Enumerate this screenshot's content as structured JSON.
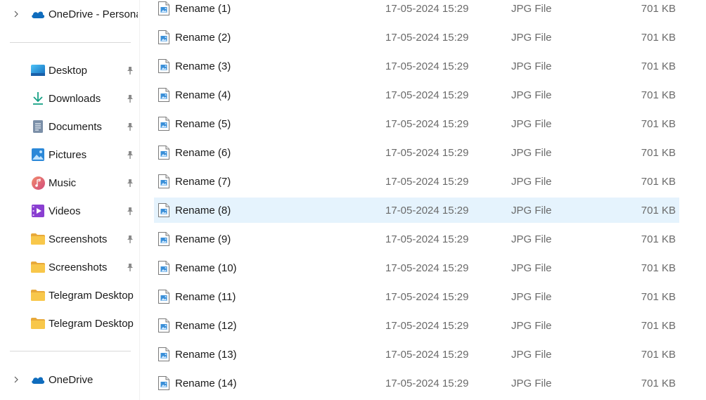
{
  "sidebar": {
    "top_item": {
      "label": "OneDrive - Persona",
      "icon": "onedrive-icon"
    },
    "quick_access": [
      {
        "label": "Desktop",
        "icon": "desktop-icon",
        "pinned": true
      },
      {
        "label": "Downloads",
        "icon": "downloads-icon",
        "pinned": true
      },
      {
        "label": "Documents",
        "icon": "documents-icon",
        "pinned": true
      },
      {
        "label": "Pictures",
        "icon": "pictures-icon",
        "pinned": true
      },
      {
        "label": "Music",
        "icon": "music-icon",
        "pinned": true
      },
      {
        "label": "Videos",
        "icon": "videos-icon",
        "pinned": true
      },
      {
        "label": "Screenshots",
        "icon": "folder-icon",
        "pinned": true
      },
      {
        "label": "Screenshots",
        "icon": "folder-icon",
        "pinned": true
      },
      {
        "label": "Telegram Desktop",
        "icon": "folder-icon",
        "pinned": false
      },
      {
        "label": "Telegram Desktop",
        "icon": "folder-icon",
        "pinned": false
      }
    ],
    "bottom_item": {
      "label": "OneDrive",
      "icon": "onedrive-icon"
    }
  },
  "files": [
    {
      "name": "Rename (1)",
      "date": "17-05-2024 15:29",
      "type": "JPG File",
      "size": "701 KB"
    },
    {
      "name": "Rename (2)",
      "date": "17-05-2024 15:29",
      "type": "JPG File",
      "size": "701 KB"
    },
    {
      "name": "Rename (3)",
      "date": "17-05-2024 15:29",
      "type": "JPG File",
      "size": "701 KB"
    },
    {
      "name": "Rename (4)",
      "date": "17-05-2024 15:29",
      "type": "JPG File",
      "size": "701 KB"
    },
    {
      "name": "Rename (5)",
      "date": "17-05-2024 15:29",
      "type": "JPG File",
      "size": "701 KB"
    },
    {
      "name": "Rename (6)",
      "date": "17-05-2024 15:29",
      "type": "JPG File",
      "size": "701 KB"
    },
    {
      "name": "Rename (7)",
      "date": "17-05-2024 15:29",
      "type": "JPG File",
      "size": "701 KB"
    },
    {
      "name": "Rename (8)",
      "date": "17-05-2024 15:29",
      "type": "JPG File",
      "size": "701 KB",
      "selected": true
    },
    {
      "name": "Rename (9)",
      "date": "17-05-2024 15:29",
      "type": "JPG File",
      "size": "701 KB"
    },
    {
      "name": "Rename (10)",
      "date": "17-05-2024 15:29",
      "type": "JPG File",
      "size": "701 KB"
    },
    {
      "name": "Rename (11)",
      "date": "17-05-2024 15:29",
      "type": "JPG File",
      "size": "701 KB"
    },
    {
      "name": "Rename (12)",
      "date": "17-05-2024 15:29",
      "type": "JPG File",
      "size": "701 KB"
    },
    {
      "name": "Rename (13)",
      "date": "17-05-2024 15:29",
      "type": "JPG File",
      "size": "701 KB"
    },
    {
      "name": "Rename (14)",
      "date": "17-05-2024 15:29",
      "type": "JPG File",
      "size": "701 KB"
    }
  ],
  "colors": {
    "selection": "#e5f3fd",
    "onedrive": "#0f6cbd",
    "folder": "#f8c74a",
    "secondary_text": "#6a6a6a"
  }
}
